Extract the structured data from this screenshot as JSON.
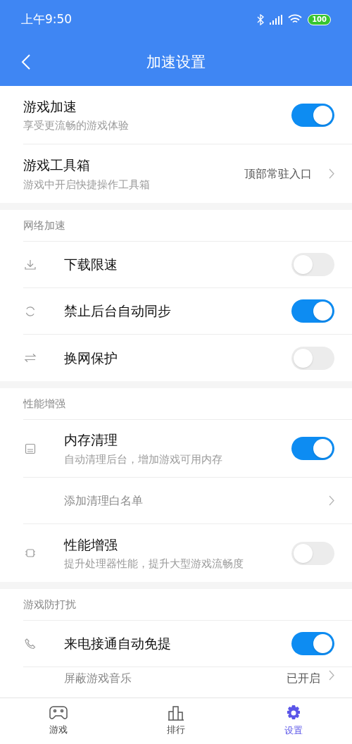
{
  "status_bar": {
    "time": "上午9:50",
    "battery": "100"
  },
  "header": {
    "title": "加速设置"
  },
  "top_items": [
    {
      "kind": "toggle",
      "title": "游戏加速",
      "subtitle": "享受更流畅的游戏体验",
      "on": true
    },
    {
      "kind": "link",
      "title": "游戏工具箱",
      "subtitle": "游戏中开启快捷操作工具箱",
      "value": "顶部常驻入口"
    }
  ],
  "sections": [
    {
      "title": "网络加速",
      "items": [
        {
          "kind": "toggle",
          "title": "下载限速",
          "on": false
        },
        {
          "kind": "toggle",
          "title": "禁止后台自动同步",
          "on": true
        },
        {
          "kind": "toggle",
          "title": "换网保护",
          "on": false
        }
      ]
    },
    {
      "title": "性能增强",
      "items": [
        {
          "kind": "toggle",
          "title": "内存清理",
          "subtitle": "自动清理后台，增加游戏可用内存",
          "on": true
        },
        {
          "kind": "sublink",
          "title": "添加清理白名单"
        },
        {
          "kind": "toggle",
          "title": "性能增强",
          "subtitle": "提升处理器性能，提升大型游戏流畅度",
          "on": false
        }
      ]
    },
    {
      "title": "游戏防打扰",
      "items": [
        {
          "kind": "toggle",
          "title": "来电接通自动免提",
          "on": true
        },
        {
          "kind": "sublink",
          "title": "屏蔽游戏音乐",
          "value": "已开启"
        }
      ]
    }
  ],
  "bottom_nav": [
    {
      "label": "游戏",
      "selected": false
    },
    {
      "label": "排行",
      "selected": false
    },
    {
      "label": "设置",
      "selected": true
    }
  ]
}
